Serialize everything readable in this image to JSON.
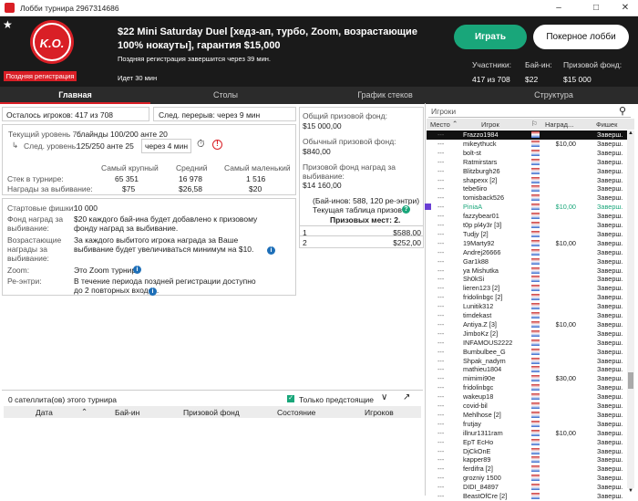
{
  "window": {
    "title": "Лобби турнира 2967314686"
  },
  "header": {
    "logo_text": "K.O.",
    "late_reg_badge": "Поздняя регистрация",
    "title": "$22 Mini Saturday Duel [хедз-ап, турбо, Zoom, возрастающие 100% нокауты], гарантия $15,000",
    "late_reg_info": "Поздняя регистрация завершится через 39 мин.",
    "running": "Идет 30 мин",
    "play_label": "Играть",
    "lobby_label": "Покерное лобби",
    "participants_label": "Участники:",
    "participants_value": "417 из 708",
    "buyin_label": "Бай-ин:",
    "buyin_value": "$22",
    "prize_label": "Призовой фонд:",
    "prize_value": "$15 000"
  },
  "tabs": [
    "Главная",
    "Столы",
    "График стеков",
    "Структура"
  ],
  "main": {
    "players_left": "Осталось игроков: 417 из 708",
    "next_break": "След. перерыв: через 9 мин",
    "current_level_label": "Текущий уровень 7:",
    "current_level_value": "блайнды 100/200 анте  20",
    "next_level_label": "След. уровень:",
    "next_level_value": "125/250 анте  25",
    "next_level_time": "через 4 мин",
    "stack_headers": [
      "Самый крупный",
      "Средний",
      "Самый маленький"
    ],
    "stack_label": "Стек в турнире:",
    "stack_values": [
      "65 351",
      "16 978",
      "1 516"
    ],
    "bounty_label": "Награды за выбивание:",
    "bounty_values": [
      "$75",
      "$26,58",
      "$20"
    ],
    "starting_chips_label": "Стартовые фишки:",
    "starting_chips_value": "10 000",
    "bounty_fund_label": "Фонд наград за выбивание:",
    "bounty_fund_value": "$20 каждого бай-ина будет добавлено к призовому фонду наград за выбивание.",
    "increasing_label": "Возрастающие награды за выбивание:",
    "increasing_value": "За каждого выбитого игрока награда за Ваше выбивание будет увеличиваться минимум на $10.",
    "zoom_label": "Zoom:",
    "zoom_value": "Это Zoom турнир.",
    "reentry_label": "Ре-энтри:",
    "reentry_value": "В течение периода поздней регистрации доступно до 2 повторных входов."
  },
  "prize": {
    "total_label": "Общий призовой фонд:",
    "total_value": "$15 000,00",
    "regular_label": "Обычный призовой фонд:",
    "regular_value": "$840,00",
    "bounty_label": "Призовой фонд наград за выбивание:",
    "bounty_value": "$14 160,00",
    "buyins": "(Бай-инов: 588, 120 ре-энтри)",
    "table_label": "Текущая таблица призов",
    "places": "Призовых мест: 2.",
    "rows": [
      {
        "place": "1",
        "amount": "$588,00"
      },
      {
        "place": "2",
        "amount": "$252,00"
      }
    ]
  },
  "satellites": {
    "title": "0 сателлита(ов) этого турнира",
    "upcoming_label": "Только предстоящие",
    "columns": [
      "Дата",
      "Бай-ин",
      "Призовой фонд",
      "Состояние",
      "Игроков"
    ]
  },
  "players": {
    "search_placeholder": "Игроки",
    "columns": [
      "Место",
      "Игрок",
      "Наград...",
      "Фишек"
    ],
    "rows": [
      {
        "place": "---",
        "name": "Frazzo1984",
        "bounty": "",
        "status": "Заверш.",
        "selected": true
      },
      {
        "place": "---",
        "name": "mikeythuck",
        "bounty": "$10,00",
        "status": "Заверш."
      },
      {
        "place": "---",
        "name": "bolt-st",
        "bounty": "",
        "status": "Заверш."
      },
      {
        "place": "---",
        "name": "Ratmirstars",
        "bounty": "",
        "status": "Заверш."
      },
      {
        "place": "---",
        "name": "Blitzburgh26",
        "bounty": "",
        "status": "Заверш."
      },
      {
        "place": "---",
        "name": "shapexx [2]",
        "bounty": "",
        "status": "Заверш."
      },
      {
        "place": "---",
        "name": "tebe6iro",
        "bounty": "",
        "status": "Заверш."
      },
      {
        "place": "---",
        "name": "tomisback526",
        "bounty": "",
        "status": "Заверш."
      },
      {
        "place": "---",
        "name": "PiniaA",
        "bounty": "$10,00",
        "status": "Заверш.",
        "green": true
      },
      {
        "place": "---",
        "name": "fazzybear01",
        "bounty": "",
        "status": "Заверш."
      },
      {
        "place": "---",
        "name": "t0p pl4y3r [3]",
        "bounty": "",
        "status": "Заверш."
      },
      {
        "place": "---",
        "name": "Tudjy [2]",
        "bounty": "",
        "status": "Заверш."
      },
      {
        "place": "---",
        "name": "19Marty92",
        "bounty": "$10,00",
        "status": "Заверш."
      },
      {
        "place": "---",
        "name": "Andrej26666",
        "bounty": "",
        "status": "Заверш."
      },
      {
        "place": "---",
        "name": "Gar1k88",
        "bounty": "",
        "status": "Заверш."
      },
      {
        "place": "---",
        "name": "ya Mishutka",
        "bounty": "",
        "status": "Заверш."
      },
      {
        "place": "---",
        "name": "Sh0kSi",
        "bounty": "",
        "status": "Заверш."
      },
      {
        "place": "---",
        "name": "lieren123 [2]",
        "bounty": "",
        "status": "Заверш."
      },
      {
        "place": "---",
        "name": "fridolinbgc [2]",
        "bounty": "",
        "status": "Заверш."
      },
      {
        "place": "---",
        "name": "Lunitik312",
        "bounty": "",
        "status": "Заверш."
      },
      {
        "place": "---",
        "name": "timdekast",
        "bounty": "",
        "status": "Заверш."
      },
      {
        "place": "---",
        "name": "Antiya.Z [3]",
        "bounty": "$10,00",
        "status": "Заверш."
      },
      {
        "place": "---",
        "name": "JimboKz [2]",
        "bounty": "",
        "status": "Заверш."
      },
      {
        "place": "---",
        "name": "INFAMOUS2222",
        "bounty": "",
        "status": "Заверш."
      },
      {
        "place": "---",
        "name": "Bumbulbee_G",
        "bounty": "",
        "status": "Заверш."
      },
      {
        "place": "---",
        "name": "Shpak_nadym",
        "bounty": "",
        "status": "Заверш."
      },
      {
        "place": "---",
        "name": "mathieu1804",
        "bounty": "",
        "status": "Заверш."
      },
      {
        "place": "---",
        "name": "mimimi90e",
        "bounty": "$30,00",
        "status": "Заверш."
      },
      {
        "place": "---",
        "name": "fridolinbgc",
        "bounty": "",
        "status": "Заверш."
      },
      {
        "place": "---",
        "name": "wakeup18",
        "bounty": "",
        "status": "Заверш."
      },
      {
        "place": "---",
        "name": "covid-bil",
        "bounty": "",
        "status": "Заверш."
      },
      {
        "place": "---",
        "name": "Mehlhose [2]",
        "bounty": "",
        "status": "Заверш."
      },
      {
        "place": "---",
        "name": "frutjay",
        "bounty": "",
        "status": "Заверш."
      },
      {
        "place": "---",
        "name": "illnur1311ram",
        "bounty": "$10,00",
        "status": "Заверш."
      },
      {
        "place": "---",
        "name": "EpT EcHo",
        "bounty": "",
        "status": "Заверш."
      },
      {
        "place": "---",
        "name": "DjCkOnE",
        "bounty": "",
        "status": "Заверш."
      },
      {
        "place": "---",
        "name": "kapper89",
        "bounty": "",
        "status": "Заверш."
      },
      {
        "place": "---",
        "name": "ferdifra [2]",
        "bounty": "",
        "status": "Заверш."
      },
      {
        "place": "---",
        "name": "grozniy 1500",
        "bounty": "",
        "status": "Заверш."
      },
      {
        "place": "---",
        "name": "DIDI_84897",
        "bounty": "",
        "status": "Заверш."
      },
      {
        "place": "---",
        "name": "BeastOfCre [2]",
        "bounty": "",
        "status": "Заверш."
      }
    ]
  }
}
